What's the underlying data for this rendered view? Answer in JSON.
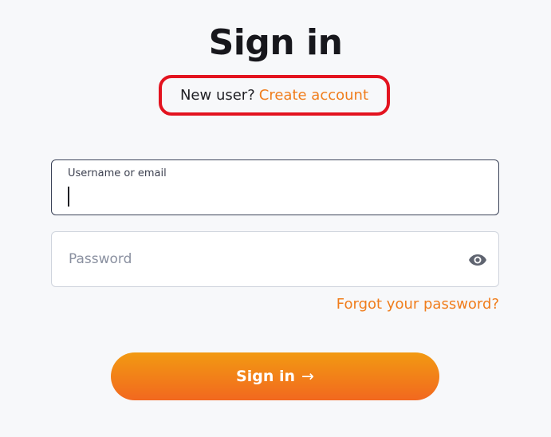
{
  "header": {
    "title": "Sign in",
    "new_user_prefix": "New user?",
    "create_account_link": "Create account"
  },
  "form": {
    "username": {
      "label": "Username or email",
      "value": ""
    },
    "password": {
      "placeholder": "Password",
      "value": "",
      "toggle_icon": "eye-icon"
    },
    "forgot_password_link": "Forgot your password?",
    "submit_label": "Sign in",
    "submit_arrow": "→"
  },
  "colors": {
    "accent": "#f07d1c",
    "highlight_border": "#e3131f",
    "button_gradient_top": "#f29a12",
    "button_gradient_bottom": "#f2681f",
    "background": "#f7f8fa"
  }
}
